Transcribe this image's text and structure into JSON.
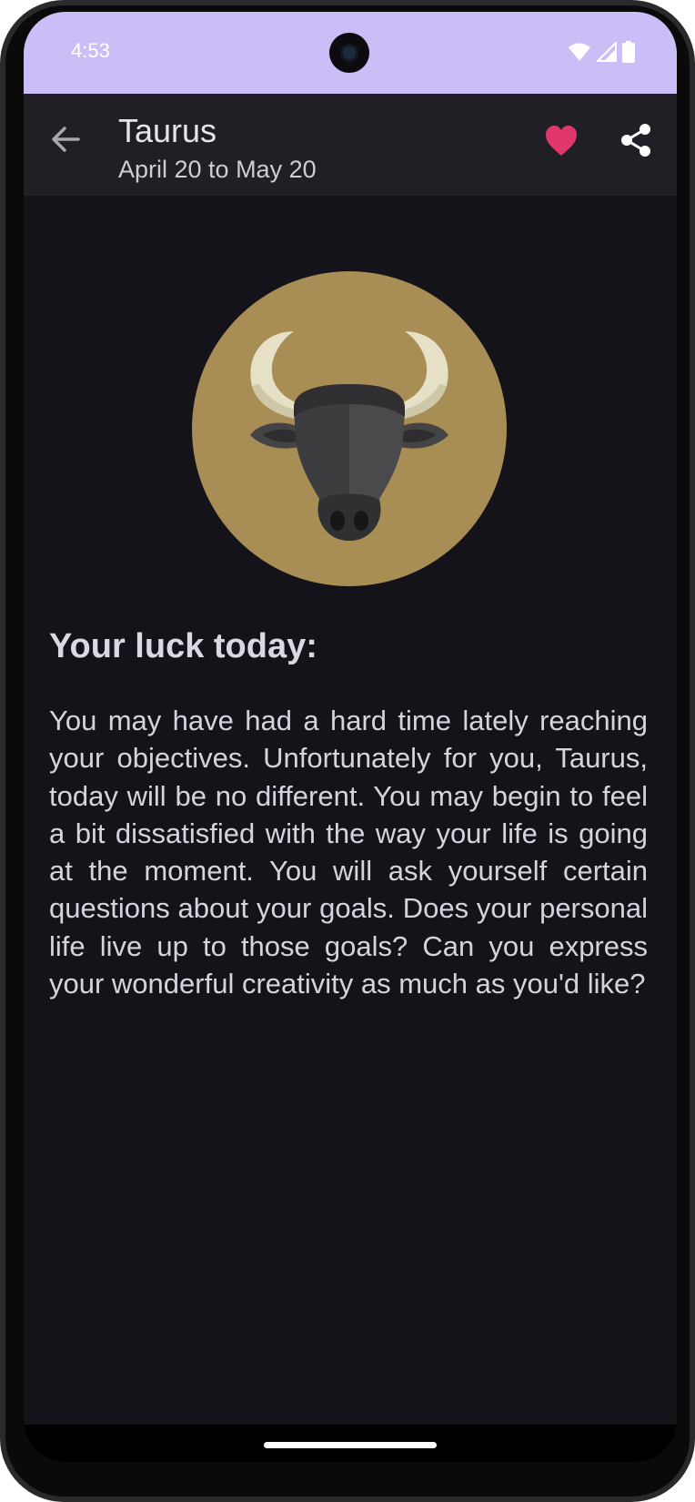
{
  "status_bar": {
    "time": "4:53",
    "icons": [
      "wifi-icon",
      "cell-signal-icon",
      "battery-icon"
    ]
  },
  "app_bar": {
    "back_icon": "arrow-back-icon",
    "title": "Taurus",
    "subtitle": "April 20 to May 20",
    "favorite_icon": "heart-icon",
    "share_icon": "share-icon"
  },
  "content": {
    "sign_image": "taurus-bull-icon",
    "section_title": "Your luck today:",
    "horoscope": "You may have had a hard time lately reaching your objectives. Unfortunately for you, Taurus, today will be no different. You may begin to feel a bit dissatisfied with the way your life is going at the moment. You will ask yourself certain questions about your goals. Does your personal life live up to those goals? Can you express your wonderful creativity as much as you'd like?"
  },
  "colors": {
    "status_bar_bg": "#cdbdf6",
    "app_bar_bg": "#201f25",
    "screen_bg": "#15131a",
    "accent_heart": "#e0386b",
    "sign_circle": "#a88d55"
  }
}
